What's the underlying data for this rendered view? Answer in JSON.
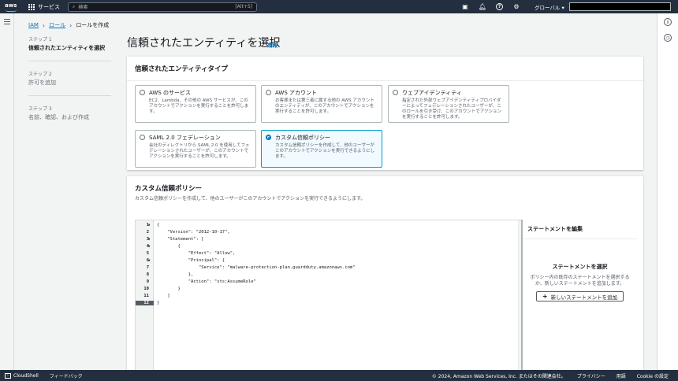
{
  "topnav": {
    "logo": "aws",
    "services": "サービス",
    "search_placeholder": "検索",
    "search_shortcut": "[Alt+S]",
    "region": "グローバル ▾",
    "icons": [
      "cloudshell-icon",
      "bell-icon",
      "help-icon",
      "gear-icon"
    ]
  },
  "breadcrumb": {
    "items": [
      "IAM",
      "ロール",
      "ロールを作成"
    ]
  },
  "steps": [
    {
      "num": "ステップ 1",
      "title": "信頼されたエンティティを選択"
    },
    {
      "num": "ステップ 2",
      "title": "許可を追加"
    },
    {
      "num": "ステップ 3",
      "title": "名前、確認、および作成"
    }
  ],
  "page": {
    "title": "信頼されたエンティティを選択",
    "info": "情報"
  },
  "entity_panel": {
    "title": "信頼されたエンティティタイプ",
    "options": [
      {
        "title": "AWS のサービス",
        "desc": "EC2、Lambda、その他の AWS サービスが、このアカウントでアクションを実行することを許可します。",
        "selected": false
      },
      {
        "title": "AWS アカウント",
        "desc": "お客様または第三者に属する他の AWS アカウントのエンティティが、このアカウントでアクションを実行することを許可します。",
        "selected": false
      },
      {
        "title": "ウェブアイデンティティ",
        "desc": "指定された外部ウェブアイデンティティプロバイダーによってフェデレーションされたユーザーが、このロールを引き受け、このアカウントでアクションを実行することを許可します。",
        "selected": false
      },
      {
        "title": "SAML 2.0 フェデレーション",
        "desc": "会社のディレクトリから SAML 2.0 を使用してフェデレーションされたユーザーが、このアカウントでアクションを実行することを許可します。",
        "selected": false
      },
      {
        "title": "カスタム信頼ポリシー",
        "desc": "カスタム信頼ポリシーを作成して、他のユーザーがこのアカウントでアクションを実行できるようにします。",
        "selected": true
      }
    ]
  },
  "policy_panel": {
    "title": "カスタム信頼ポリシー",
    "subtitle": "カスタム信頼ポリシーを作成して、他のユーザーがこのアカウントでアクションを実行できるようにします。",
    "code_lines": [
      {
        "n": "1",
        "fold": true,
        "text": "{"
      },
      {
        "n": "2",
        "fold": false,
        "text": "    \"Version\": \"2012-10-17\","
      },
      {
        "n": "3",
        "fold": true,
        "text": "    \"Statement\": ["
      },
      {
        "n": "4",
        "fold": true,
        "text": "        {"
      },
      {
        "n": "5",
        "fold": false,
        "text": "            \"Effect\": \"Allow\","
      },
      {
        "n": "6",
        "fold": true,
        "text": "            \"Principal\": {"
      },
      {
        "n": "7",
        "fold": false,
        "text": "                \"Service\": \"malware-protection-plan.guardduty.amazonaws.com\""
      },
      {
        "n": "8",
        "fold": false,
        "text": "            },"
      },
      {
        "n": "9",
        "fold": false,
        "text": "            \"Action\": \"sts:AssumeRole\""
      },
      {
        "n": "10",
        "fold": false,
        "text": "        }"
      },
      {
        "n": "11",
        "fold": false,
        "text": "    ]"
      },
      {
        "n": "12",
        "fold": false,
        "text": "}"
      }
    ],
    "active_line": "12",
    "side_header": "ステートメントを編集",
    "side_title": "ステートメントを選択",
    "side_desc": "ポリシー内の既存のステートメントを選択するか、新しいステートメントを追加します。",
    "add_button": "新しいステートメントを追加"
  },
  "footer": {
    "cloudshell": "CloudShell",
    "feedback": "フィードバック",
    "copyright": "© 2024, Amazon Web Services, Inc. またはその関連会社。",
    "privacy": "プライバシー",
    "terms": "用語",
    "cookies": "Cookie の設定"
  }
}
